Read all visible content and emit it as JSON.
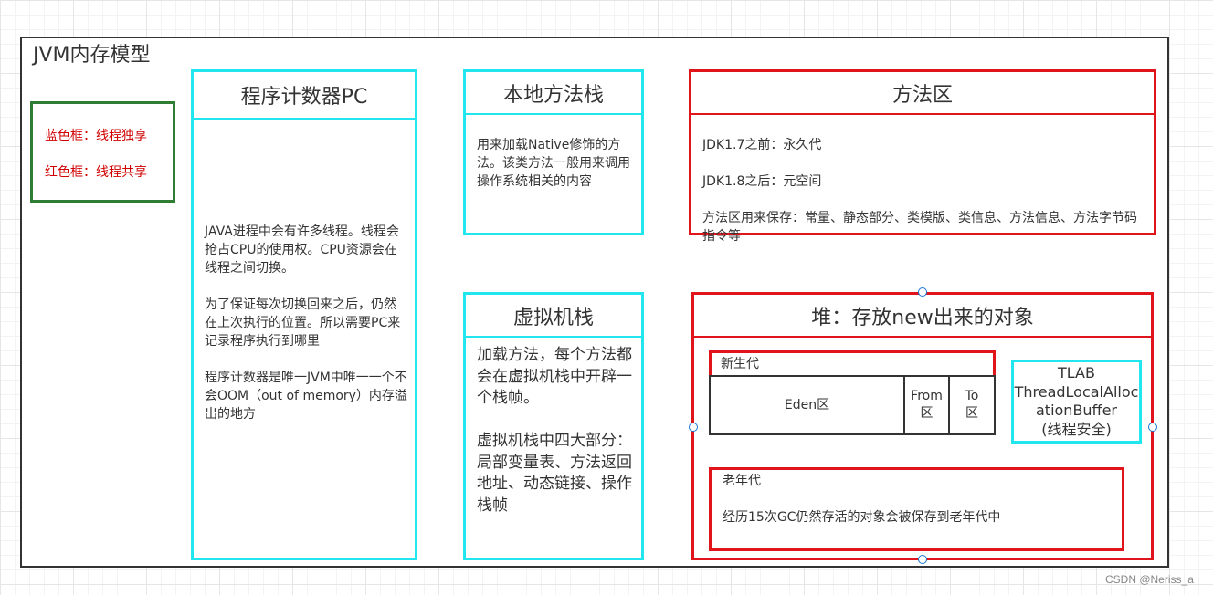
{
  "title": "JVM内存模型",
  "legend": {
    "blue": "蓝色框：线程独享",
    "red": "红色框：线程共享"
  },
  "pc": {
    "title": "程序计数器PC",
    "body": "JAVA进程中会有许多线程。线程会抢占CPU的使用权。CPU资源会在线程之间切换。\n\n为了保证每次切换回来之后，仍然在上次执行的位置。所以需要PC来记录程序执行到哪里\n\n程序计数器是唯一JVM中唯一一个不会OOM（out of memory）内存溢出的地方"
  },
  "native_stack": {
    "title": "本地方法栈",
    "body": "用来加载Native修饰的方法。该类方法一般用来调用操作系统相关的内容"
  },
  "vm_stack": {
    "title": "虚拟机栈",
    "body": "加载方法，每个方法都会在虚拟机栈中开辟一个栈帧。\n\n虚拟机栈中四大部分：\n局部变量表、方法返回地址、动态链接、操作栈帧"
  },
  "method_area": {
    "title": "方法区",
    "lines": [
      "JDK1.7之前：永久代",
      "JDK1.8之后：元空间",
      "方法区用来保存：常量、静态部分、类模版、类信息、方法信息、方法字节码指令等"
    ]
  },
  "heap": {
    "title": "堆：存放new出来的对象",
    "young": {
      "label": "新生代",
      "eden": "Eden区",
      "from": "From\n区",
      "to": "To\n区"
    },
    "tlab": "TLAB\nThreadLocalAllocationBuffer\n(线程安全)",
    "old": {
      "label": "老年代",
      "body": "经历15次GC仍然存活的对象会被保存到老年代中"
    }
  },
  "watermark": "CSDN @Neriss_a",
  "colors": {
    "thread_private": "#22e6ee",
    "thread_shared": "#e0141b",
    "legend_border": "#2e7d32",
    "legend_text": "#d00000"
  }
}
